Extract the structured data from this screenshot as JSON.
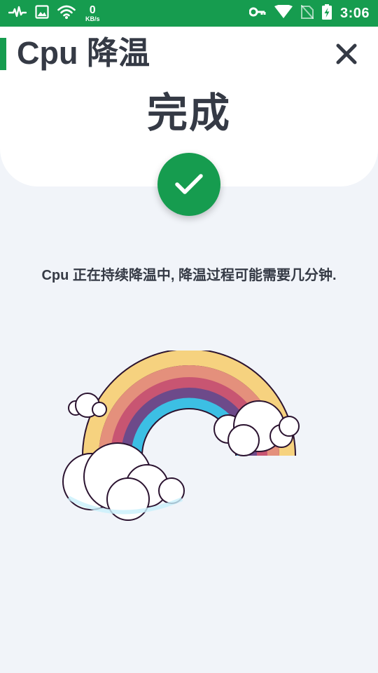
{
  "status_bar": {
    "net_speed_value": "0",
    "net_speed_unit": "KB/s",
    "time": "3:06",
    "icons": [
      "pulse-icon",
      "image-icon",
      "wifi-icon",
      "key-icon",
      "signal-icon",
      "no-sim-icon",
      "battery-charging-icon"
    ],
    "background": "#169c4f"
  },
  "header": {
    "title": "Cpu 降温",
    "close_icon": "close-icon"
  },
  "result": {
    "status_text": "完成",
    "badge_icon": "checkmark-icon",
    "badge_color": "#169c4f"
  },
  "message": "Cpu 正在持续降温中, 降温过程可能需要几分钟.",
  "illustration": {
    "icon": "rainbow-clouds-illustration"
  },
  "colors": {
    "accent": "#169c4f",
    "text": "#353a45",
    "background": "#f1f4f9",
    "card": "#ffffff"
  }
}
